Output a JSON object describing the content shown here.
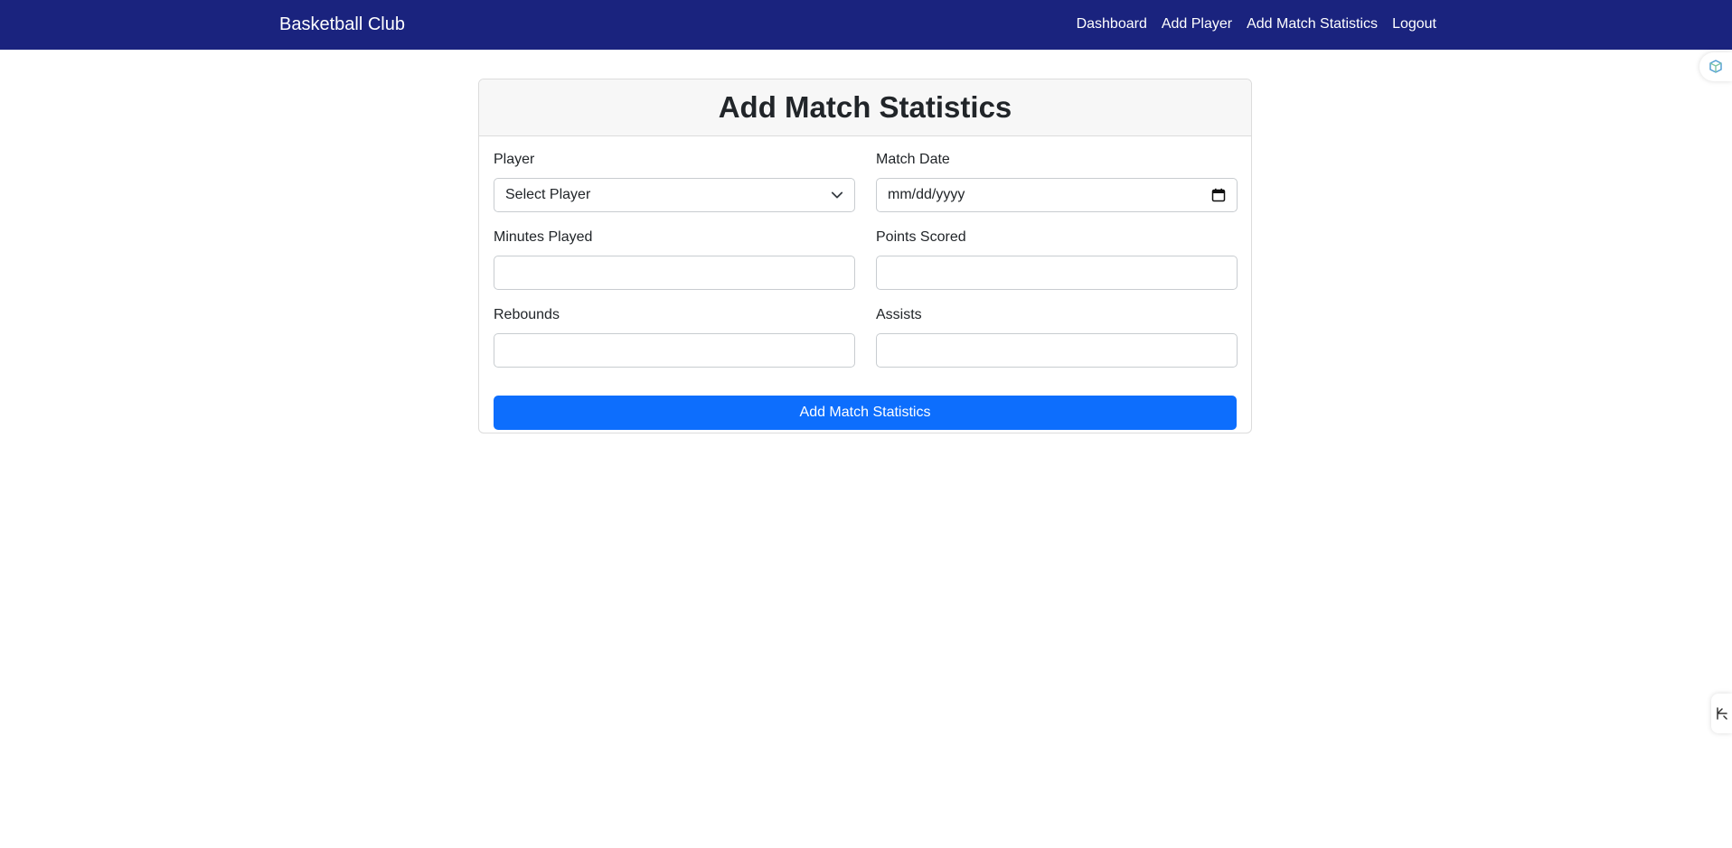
{
  "navbar": {
    "brand": "Basketball Club",
    "links": [
      "Dashboard",
      "Add Player",
      "Add Match Statistics",
      "Logout"
    ],
    "background": "#1a237e"
  },
  "form": {
    "title": "Add Match Statistics",
    "fields": {
      "player": {
        "label": "Player",
        "value": "Select Player"
      },
      "match_date": {
        "label": "Match Date",
        "placeholder": "mm/dd/yyyy"
      },
      "minutes_played": {
        "label": "Minutes Played",
        "value": ""
      },
      "points_scored": {
        "label": "Points Scored",
        "value": ""
      },
      "rebounds": {
        "label": "Rebounds",
        "value": ""
      },
      "assists": {
        "label": "Assists",
        "value": ""
      }
    },
    "submit_label": "Add Match Statistics",
    "submit_color": "#0d6efd"
  },
  "icons": {
    "select": "chevron-down-icon",
    "date": "calendar-icon",
    "extension_top": "extension-icon",
    "extension_bottom": "sidebar-toggle-icon"
  }
}
